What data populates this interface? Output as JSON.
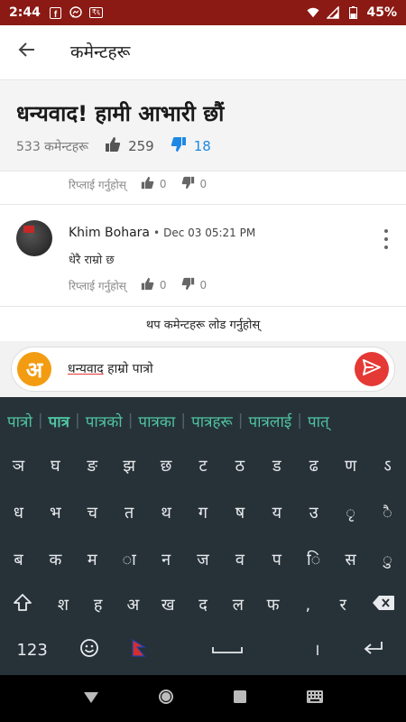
{
  "status_bar": {
    "time": "2:44",
    "badge": "₹६",
    "battery": "45%"
  },
  "app_bar": {
    "title": "कमेन्टहरू"
  },
  "header": {
    "title": "धन्यवाद! हामी आभारी छौं",
    "comment_count": "533 कमेन्टहरू",
    "likes": "259",
    "dislikes": "18"
  },
  "previous_comment": {
    "reply_label": "रिप्लाई गर्नुहोस्",
    "likes": "0",
    "dislikes": "0"
  },
  "comment": {
    "author": "Khim Bohara",
    "separator": "•",
    "date": "Dec 03 05:21 PM",
    "text": "धेरै राम्रो छ",
    "reply_label": "रिप्लाई गर्नुहोस्",
    "likes": "0",
    "dislikes": "0"
  },
  "load_more": "थप कमेन्टहरू लोड गर्नुहोस्",
  "input": {
    "logo_letter": "अ",
    "word1": "धन्यवाद",
    "word2": " हाम्रो पात्रो"
  },
  "keyboard": {
    "suggestions": [
      "पात्रो",
      "पात्र",
      "पात्रको",
      "पात्रका",
      "पात्रहरू",
      "पात्रलाई",
      "पात्"
    ],
    "row1": [
      "ञ",
      "घ",
      "ङ",
      "झ",
      "छ",
      "ट",
      "ठ",
      "ड",
      "ढ",
      "ण",
      "ऽ"
    ],
    "row2": [
      "ध",
      "भ",
      "च",
      "त",
      "थ",
      "ग",
      "ष",
      "य",
      "उ",
      "ृ",
      "ै"
    ],
    "row3": [
      "ब",
      "क",
      "म",
      "ा",
      "न",
      "ज",
      "व",
      "प",
      "ि",
      "स",
      "ु"
    ],
    "row4": [
      "श",
      "ह",
      "अ",
      "ख",
      "द",
      "ल",
      "फ",
      ",",
      "र"
    ],
    "numbers_label": "123",
    "period": "।"
  },
  "colors": {
    "status_bar": "#8b1a14",
    "keyboard_bg": "#263238",
    "suggestion": "#4fc3a1",
    "accent_blue": "#1e88e5",
    "send_red": "#e53935",
    "logo_orange": "#f39c12"
  }
}
